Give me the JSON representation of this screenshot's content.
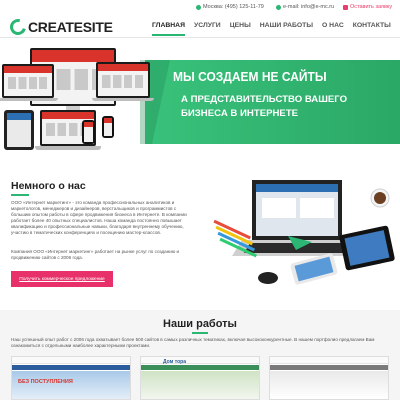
{
  "topbar": {
    "phone_label": "Москва: (495) 125-11-79",
    "email_label": "e-mail: info@e-mc.ru",
    "order_label": "Оставить заявку"
  },
  "logo": {
    "text": "CREATESITE"
  },
  "nav": {
    "items": [
      {
        "label": "ГЛАВНАЯ",
        "active": true
      },
      {
        "label": "УСЛУГИ",
        "active": false
      },
      {
        "label": "ЦЕНЫ",
        "active": false
      },
      {
        "label": "НАШИ РАБОТЫ",
        "active": false
      },
      {
        "label": "О НАС",
        "active": false
      },
      {
        "label": "КОНТАКТЫ",
        "active": false
      }
    ]
  },
  "hero": {
    "line1": "МЫ СОЗДАЕМ НЕ САЙТЫ",
    "line2": "А ПРЕДСТАВИТЕЛЬСТВО ВАШЕГО",
    "line3": "БИЗНЕСА В ИНТЕРНЕТЕ"
  },
  "about": {
    "title": "Немного о нас",
    "p1": "ООО «Интернет маркетинг» - это команда профессиональных аналитиков и маркетологов, менеджеров и дизайнеров, верстальщиков и программистов с большим опытом работы в сфере продвижения бизнеса в Интернете. В компании работает более 40 опытных специалистов. Наша команда постоянно повышает квалификацию и профессиональные навыки, благодаря внутреннему обучению, участию в тематических конференциях и посещению мастер-классов.",
    "p2": "Компания ООО «Интернет маркетинг» работает на рынке услуг по созданию и продвижению сайтов с 2006 года.",
    "cta_label": "Получить коммерческое предложение"
  },
  "works": {
    "title": "Наши работы",
    "description": "Наш успешный опыт работ с 2006 года охватывает более 500 сайтов в самых различных тематиках, включая высококонкурентные. В нашем портфолио предлагаем Вам ознакомиться с отдельными наиболее характерными проектами.",
    "thumbs": [
      {
        "label": "",
        "banner": "БЕЗ ПОСТУПЛЕНИЯ"
      },
      {
        "label": "Дом тора",
        "banner": ""
      },
      {
        "label": "",
        "banner": ""
      }
    ]
  },
  "colors": {
    "accent": "#2bb673",
    "cta": "#e8316a",
    "text": "#333333"
  },
  "icons": {
    "phone": "phone-icon",
    "email": "mail-icon",
    "order": "pencil-icon"
  }
}
